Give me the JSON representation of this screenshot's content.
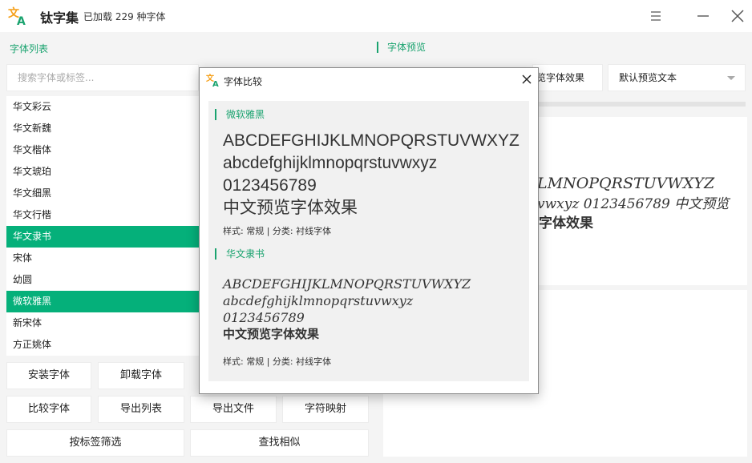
{
  "app": {
    "title": "钛字集",
    "subtitle": "已加载 229 种字体"
  },
  "font_list": {
    "label": "字体列表",
    "search_placeholder": "搜索字体或标签...",
    "items": [
      {
        "name": "华文彩云",
        "selected": false
      },
      {
        "name": "华文新魏",
        "selected": false
      },
      {
        "name": "华文楷体",
        "selected": false
      },
      {
        "name": "华文琥珀",
        "selected": false
      },
      {
        "name": "华文细黑",
        "selected": false
      },
      {
        "name": "华文行楷",
        "selected": false
      },
      {
        "name": "华文隶书",
        "selected": true
      },
      {
        "name": "宋体",
        "selected": false
      },
      {
        "name": "幼圆",
        "selected": false
      },
      {
        "name": "微软雅黑",
        "selected": true
      },
      {
        "name": "新宋体",
        "selected": false
      },
      {
        "name": "方正姚体",
        "selected": false
      }
    ]
  },
  "buttons": {
    "install": "安装字体",
    "uninstall": "卸载字体",
    "compare": "比较字体",
    "export_list": "导出列表",
    "export_file": "导出文件",
    "char_map": "字符映射",
    "filter_tags": "按标签筛选",
    "find_similar": "查找相似"
  },
  "preview": {
    "label": "字体预览",
    "effect_button": "览字体效果",
    "text_select": "默认预览文本",
    "sample_line1": "LMNOPQRSTUVWXYZ",
    "sample_line2": "vwxyz 0123456789 中文预览",
    "sample_line3": "字体效果"
  },
  "dialog": {
    "title": "字体比较",
    "fonts": [
      {
        "name": "微软雅黑",
        "upper": "ABCDEFGHIJKLMNOPQRSTUVWXYZ",
        "lower": "abcdefghijklmnopqrstuvwxyz",
        "digits": "0123456789",
        "chinese": "中文预览字体效果",
        "meta": "样式: 常规 | 分类: 衬线字体"
      },
      {
        "name": "华文隶书",
        "upper": "ABCDEFGHIJKLMNOPQRSTUVWXYZ",
        "lower": "abcdefghijklmnopqrstuvwxyz",
        "digits": "0123456789",
        "chinese": "中文预览字体效果",
        "meta": "样式: 常规 | 分类: 衬线字体"
      }
    ]
  },
  "colors": {
    "accent": "#1aa36f",
    "selected_bg": "#05b07a",
    "logo_orange": "#f5a01a",
    "logo_green": "#1aa36f"
  },
  "icons": {
    "app_logo": "translate-icon",
    "menu": "menu-icon",
    "minimize": "minimize-icon",
    "close": "close-icon",
    "dropdown": "chevron-down-icon"
  }
}
